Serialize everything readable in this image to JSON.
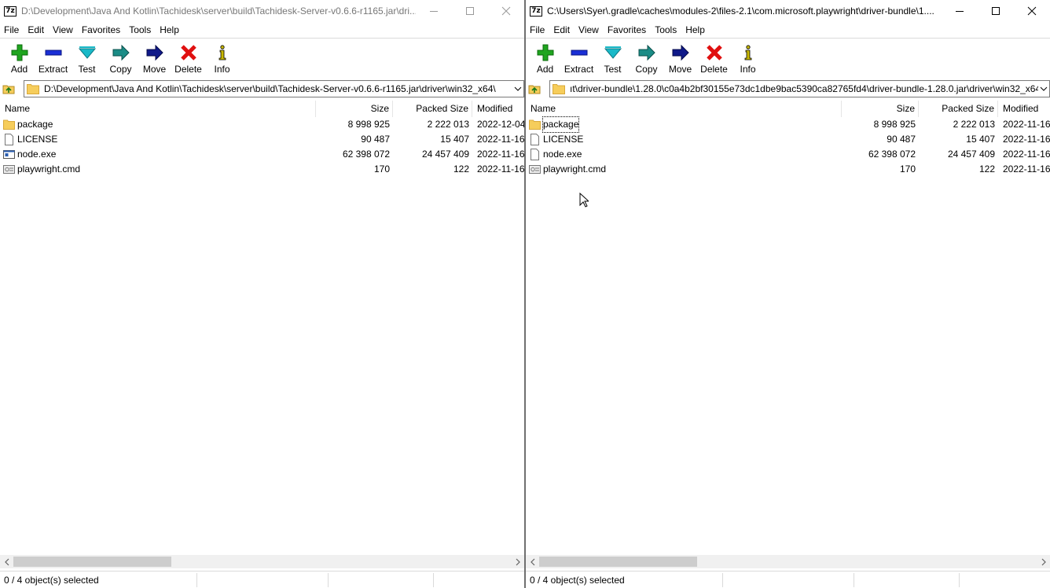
{
  "app_icon_text": "7z",
  "left": {
    "title": "D:\\Development\\Java And Kotlin\\Tachidesk\\server\\build\\Tachidesk-Server-v0.6.6-r1165.jar\\dri...",
    "menu": [
      "File",
      "Edit",
      "View",
      "Favorites",
      "Tools",
      "Help"
    ],
    "toolbar": [
      {
        "label": "Add",
        "icon": "add-icon"
      },
      {
        "label": "Extract",
        "icon": "extract-icon"
      },
      {
        "label": "Test",
        "icon": "test-icon"
      },
      {
        "label": "Copy",
        "icon": "copy-icon"
      },
      {
        "label": "Move",
        "icon": "move-icon"
      },
      {
        "label": "Delete",
        "icon": "delete-icon"
      },
      {
        "label": "Info",
        "icon": "info-icon"
      }
    ],
    "address": "D:\\Development\\Java And Kotlin\\Tachidesk\\server\\build\\Tachidesk-Server-v0.6.6-r1165.jar\\driver\\win32_x64\\",
    "columns": {
      "name": "Name",
      "size": "Size",
      "packed": "Packed Size",
      "modified": "Modified"
    },
    "rows": [
      {
        "name": "package",
        "size": "8 998 925",
        "packed": "2 222 013",
        "modified": "2022-12-04",
        "icon": "folder-icon"
      },
      {
        "name": "LICENSE",
        "size": "90 487",
        "packed": "15 407",
        "modified": "2022-11-16",
        "icon": "file-icon"
      },
      {
        "name": "node.exe",
        "size": "62 398 072",
        "packed": "24 457 409",
        "modified": "2022-11-16",
        "icon": "exe-icon"
      },
      {
        "name": "playwright.cmd",
        "size": "170",
        "packed": "122",
        "modified": "2022-11-16",
        "icon": "script-icon"
      }
    ],
    "status": "0 / 4 object(s) selected"
  },
  "right": {
    "title": "C:\\Users\\Syer\\.gradle\\caches\\modules-2\\files-2.1\\com.microsoft.playwright\\driver-bundle\\1....",
    "menu": [
      "File",
      "Edit",
      "View",
      "Favorites",
      "Tools",
      "Help"
    ],
    "toolbar": [
      {
        "label": "Add",
        "icon": "add-icon"
      },
      {
        "label": "Extract",
        "icon": "extract-icon"
      },
      {
        "label": "Test",
        "icon": "test-icon"
      },
      {
        "label": "Copy",
        "icon": "copy-icon"
      },
      {
        "label": "Move",
        "icon": "move-icon"
      },
      {
        "label": "Delete",
        "icon": "delete-icon"
      },
      {
        "label": "Info",
        "icon": "info-icon"
      }
    ],
    "address": "ıt\\driver-bundle\\1.28.0\\c0a4b2bf30155e73dc1dbe9bac5390ca82765fd4\\driver-bundle-1.28.0.jar\\driver\\win32_x64\\",
    "columns": {
      "name": "Name",
      "size": "Size",
      "packed": "Packed Size",
      "modified": "Modified"
    },
    "rows": [
      {
        "name": "package",
        "size": "8 998 925",
        "packed": "2 222 013",
        "modified": "2022-11-16",
        "icon": "folder-icon"
      },
      {
        "name": "LICENSE",
        "size": "90 487",
        "packed": "15 407",
        "modified": "2022-11-16",
        "icon": "file-icon"
      },
      {
        "name": "node.exe",
        "size": "62 398 072",
        "packed": "24 457 409",
        "modified": "2022-11-16",
        "icon": "file-icon"
      },
      {
        "name": "playwright.cmd",
        "size": "170",
        "packed": "122",
        "modified": "2022-11-16",
        "icon": "script-icon"
      }
    ],
    "status": "0 / 4 object(s) selected"
  },
  "colors": {
    "add": "#1fa51f",
    "extract": "#1a2fd6",
    "test": "#19b9c8",
    "copy": "#1b8c86",
    "move": "#101a8a",
    "delete": "#e01010",
    "info": "#c9b800",
    "folder": "#f6cd5b"
  }
}
